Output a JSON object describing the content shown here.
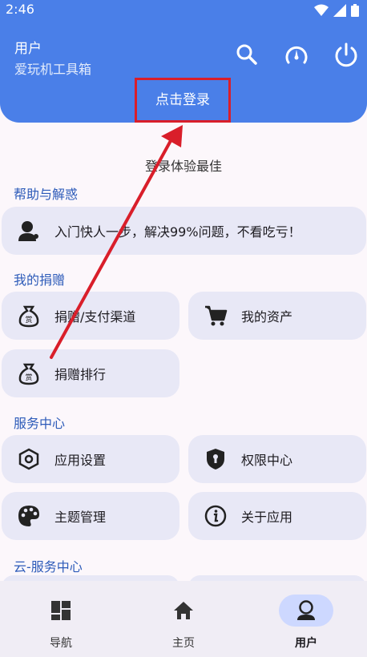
{
  "status": {
    "time": "2:46"
  },
  "header": {
    "title": "用户",
    "subtitle": "爱玩机工具箱",
    "login_label": "点击登录"
  },
  "tip": "登录体验最佳",
  "sections": {
    "help": "帮助与解惑",
    "donate": "我的捐赠",
    "service": "服务中心",
    "cloud": "云-服务中心"
  },
  "cards": {
    "help_guide": "入门快人一步，解决99%问题，不看吃亏！",
    "donate_channel": "捐赠/支付渠道",
    "my_assets": "我的资产",
    "donate_rank": "捐赠排行",
    "app_settings": "应用设置",
    "permission_center": "权限中心",
    "theme_manage": "主题管理",
    "about_app": "关于应用"
  },
  "nav": {
    "items": [
      {
        "label": "导航"
      },
      {
        "label": "主页"
      },
      {
        "label": "用户"
      }
    ],
    "active": "用户"
  },
  "colors": {
    "primary": "#4a7fe8",
    "card": "#e8e8f6",
    "section": "#2d5bb9",
    "annotation": "#d91e2a"
  },
  "icons": [
    "wifi-icon",
    "signal-icon",
    "battery-icon",
    "search-icon",
    "speedometer-icon",
    "power-icon",
    "user-help-icon",
    "money-bag-icon",
    "cart-icon",
    "hexagon-icon",
    "shield-lock-icon",
    "palette-icon",
    "info-icon",
    "dashboard-icon",
    "home-icon",
    "user-icon"
  ]
}
